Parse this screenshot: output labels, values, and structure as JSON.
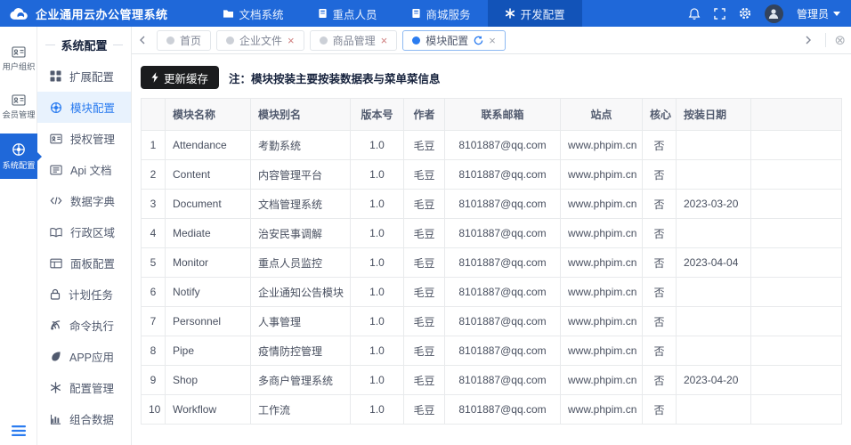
{
  "app": {
    "title": "企业通用云办公管理系统"
  },
  "colors": {
    "primary": "#1f68d9",
    "primary_dark": "#1253b8",
    "accent": "#2b7cf0",
    "button_dark": "#1b1c1e",
    "active_item_bg": "#e8f2fd"
  },
  "topnav": {
    "items": [
      {
        "label": "文档系统",
        "icon": "folder-icon"
      },
      {
        "label": "重点人员",
        "icon": "notebook-icon"
      },
      {
        "label": "商城服务",
        "icon": "notebook-icon"
      },
      {
        "label": "开发配置",
        "icon": "asterisk-icon"
      }
    ],
    "user": {
      "name": "管理员"
    }
  },
  "iconbar": {
    "items": [
      {
        "label": "用户组织"
      },
      {
        "label": "会员管理"
      },
      {
        "label": "系统配置"
      }
    ]
  },
  "sidebar": {
    "title": "系统配置",
    "items": [
      {
        "label": "扩展配置"
      },
      {
        "label": "模块配置"
      },
      {
        "label": "授权管理"
      },
      {
        "label": "Api 文档"
      },
      {
        "label": "数据字典"
      },
      {
        "label": "行政区域"
      },
      {
        "label": "面板配置"
      },
      {
        "label": "计划任务"
      },
      {
        "label": "命令执行"
      },
      {
        "label": "APP应用"
      },
      {
        "label": "配置管理"
      },
      {
        "label": "组合数据"
      }
    ]
  },
  "tabs": {
    "items": [
      {
        "label": "首页"
      },
      {
        "label": "企业文件"
      },
      {
        "label": "商品管理"
      },
      {
        "label": "模块配置"
      }
    ]
  },
  "toolbar": {
    "update_cache_label": "更新缓存",
    "note": "注：模块按装主要按装数据表与菜单菜信息"
  },
  "table": {
    "headers": [
      "模块名称",
      "模块别名",
      "版本号",
      "作者",
      "联系邮箱",
      "站点",
      "核心",
      "按装日期"
    ],
    "rows": [
      {
        "n": "1",
        "name": "Attendance",
        "alias": "考勤系统",
        "version": "1.0",
        "author": "毛豆",
        "email": "8101887@qq.com",
        "site": "www.phpim.cn",
        "core": "否",
        "date": ""
      },
      {
        "n": "2",
        "name": "Content",
        "alias": "内容管理平台",
        "version": "1.0",
        "author": "毛豆",
        "email": "8101887@qq.com",
        "site": "www.phpim.cn",
        "core": "否",
        "date": ""
      },
      {
        "n": "3",
        "name": "Document",
        "alias": "文档管理系统",
        "version": "1.0",
        "author": "毛豆",
        "email": "8101887@qq.com",
        "site": "www.phpim.cn",
        "core": "否",
        "date": "2023-03-20"
      },
      {
        "n": "4",
        "name": "Mediate",
        "alias": "治安民事调解",
        "version": "1.0",
        "author": "毛豆",
        "email": "8101887@qq.com",
        "site": "www.phpim.cn",
        "core": "否",
        "date": ""
      },
      {
        "n": "5",
        "name": "Monitor",
        "alias": "重点人员监控",
        "version": "1.0",
        "author": "毛豆",
        "email": "8101887@qq.com",
        "site": "www.phpim.cn",
        "core": "否",
        "date": "2023-04-04"
      },
      {
        "n": "6",
        "name": "Notify",
        "alias": "企业通知公告模块",
        "version": "1.0",
        "author": "毛豆",
        "email": "8101887@qq.com",
        "site": "www.phpim.cn",
        "core": "否",
        "date": ""
      },
      {
        "n": "7",
        "name": "Personnel",
        "alias": "人事管理",
        "version": "1.0",
        "author": "毛豆",
        "email": "8101887@qq.com",
        "site": "www.phpim.cn",
        "core": "否",
        "date": ""
      },
      {
        "n": "8",
        "name": "Pipe",
        "alias": "疫情防控管理",
        "version": "1.0",
        "author": "毛豆",
        "email": "8101887@qq.com",
        "site": "www.phpim.cn",
        "core": "否",
        "date": ""
      },
      {
        "n": "9",
        "name": "Shop",
        "alias": "多商户管理系统",
        "version": "1.0",
        "author": "毛豆",
        "email": "8101887@qq.com",
        "site": "www.phpim.cn",
        "core": "否",
        "date": "2023-04-20"
      },
      {
        "n": "10",
        "name": "Workflow",
        "alias": "工作流",
        "version": "1.0",
        "author": "毛豆",
        "email": "8101887@qq.com",
        "site": "www.phpim.cn",
        "core": "否",
        "date": ""
      }
    ]
  }
}
